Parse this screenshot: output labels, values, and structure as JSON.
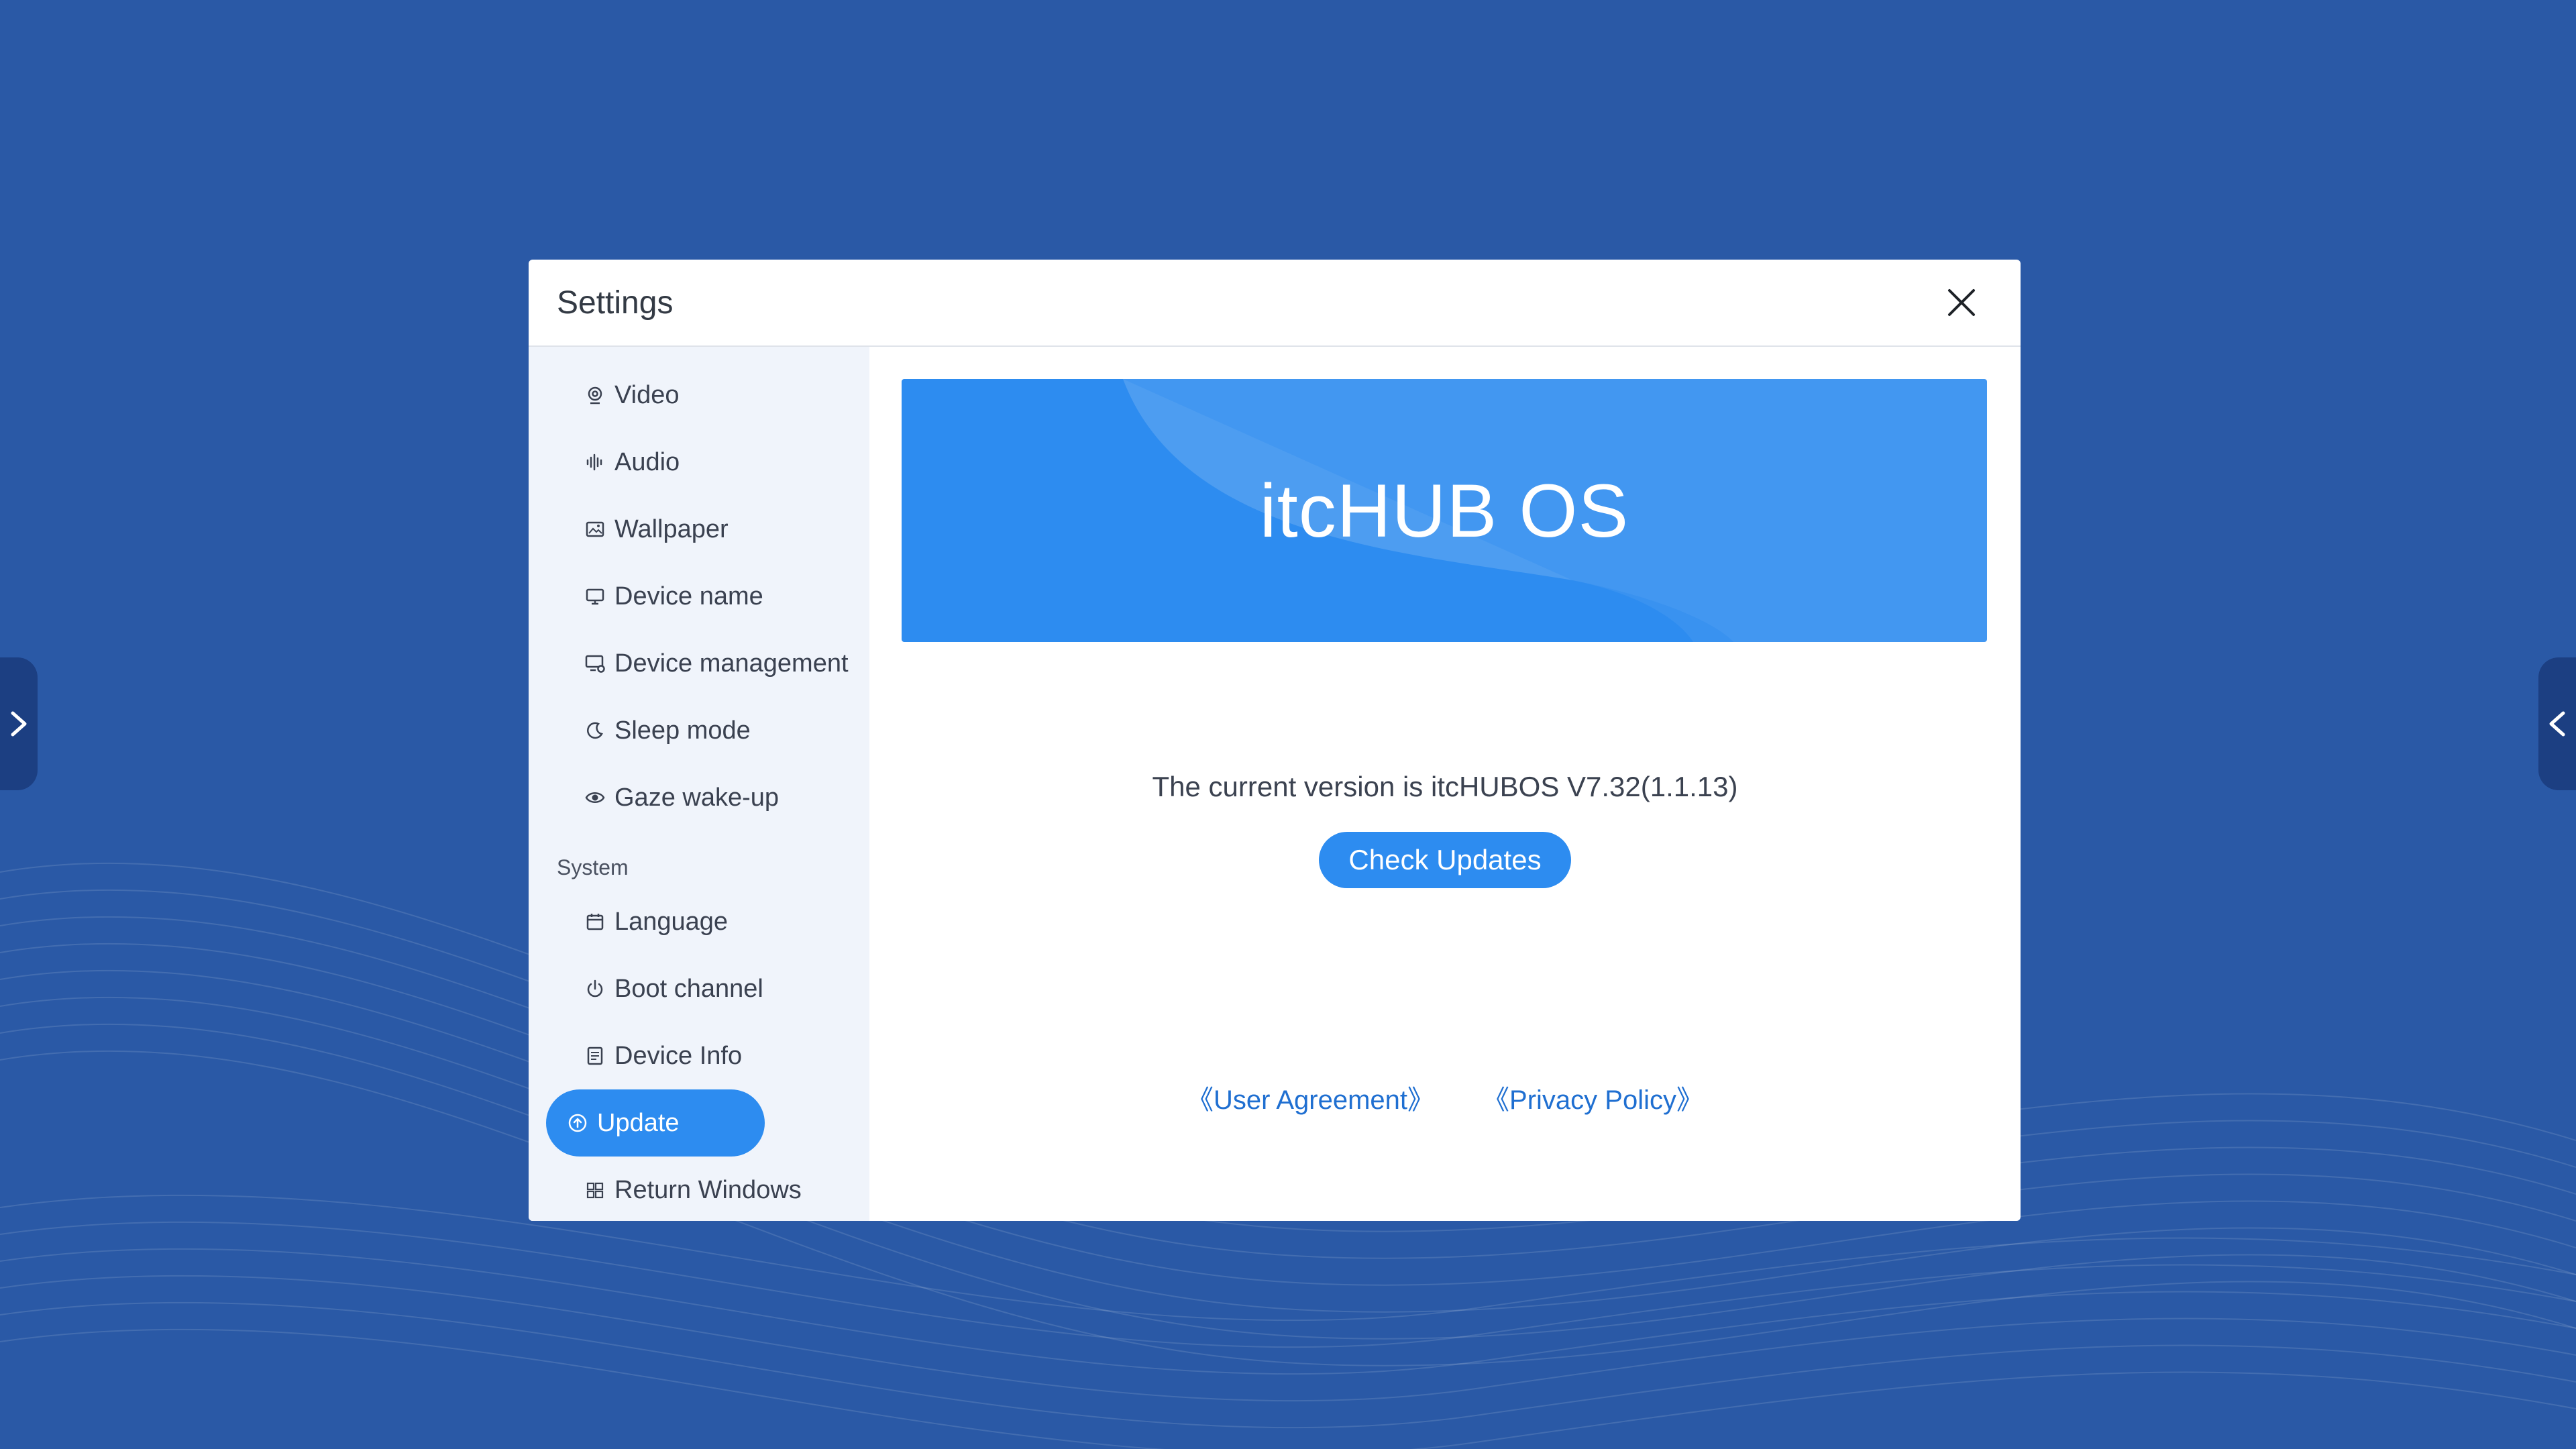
{
  "dialog": {
    "title": "Settings",
    "close_icon": "close-icon"
  },
  "sidebar": {
    "items": [
      {
        "label": "Video",
        "icon": "webcam-icon"
      },
      {
        "label": "Audio",
        "icon": "audio-wave-icon"
      },
      {
        "label": "Wallpaper",
        "icon": "image-icon"
      },
      {
        "label": "Device name",
        "icon": "monitor-icon"
      },
      {
        "label": "Device management",
        "icon": "device-gear-icon"
      },
      {
        "label": "Sleep mode",
        "icon": "moon-icon"
      },
      {
        "label": "Gaze wake-up",
        "icon": "eye-icon"
      }
    ],
    "section_label": "System",
    "system_items": [
      {
        "label": "Language",
        "icon": "calendar-icon"
      },
      {
        "label": "Boot channel",
        "icon": "power-icon"
      },
      {
        "label": "Device Info",
        "icon": "document-icon"
      },
      {
        "label": "Update",
        "icon": "upload-circle-icon",
        "active": true
      },
      {
        "label": "Return Windows",
        "icon": "windows-icon"
      }
    ]
  },
  "main": {
    "banner_title": "itcHUB OS",
    "version_text": "The current version is itcHUBOS V7.32(1.1.13)",
    "check_button": "Check Updates",
    "user_agreement": "《User Agreement》",
    "privacy_policy": "《Privacy Policy》"
  },
  "colors": {
    "background": "#2a59a6",
    "accent": "#2d8cf0",
    "link": "#1f6fd1",
    "sidebar_bg": "#f0f4fb"
  }
}
